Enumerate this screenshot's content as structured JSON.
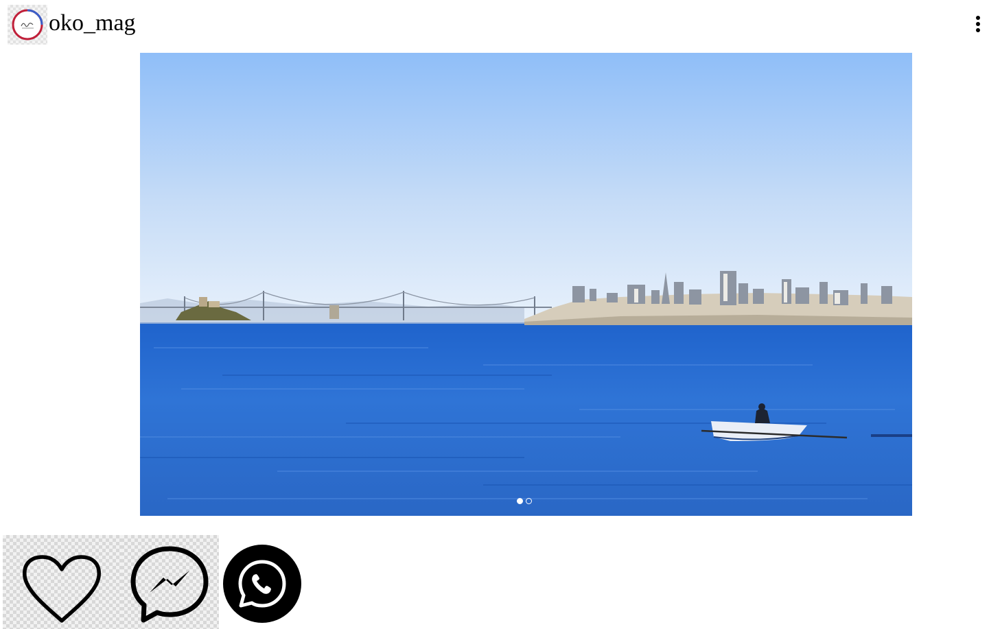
{
  "header": {
    "username": "oko_mag",
    "avatar_icon": "brand-logo-icon",
    "menu_icon": "more-vertical-icon"
  },
  "post": {
    "carousel": {
      "slide_count": 2,
      "active_index": 0
    }
  },
  "actions": {
    "like_icon": "heart-outline-icon",
    "messenger_icon": "messenger-icon",
    "whatsapp_icon": "whatsapp-icon"
  },
  "colors": {
    "sky_top": "#8fbef8",
    "sky_horizon": "#e6f0fb",
    "water": "#2d6fd0",
    "icon": "#000000"
  }
}
